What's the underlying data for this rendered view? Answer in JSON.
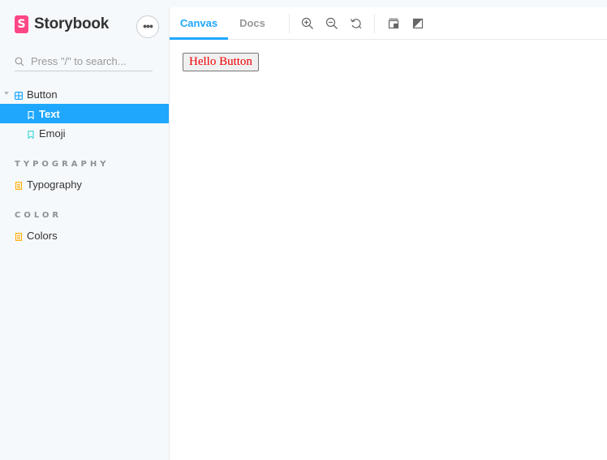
{
  "brand": {
    "logo_letter": "S",
    "name": "Storybook",
    "color": "#ff4785"
  },
  "sidebar": {
    "menu_label": "•••",
    "search_placeholder": "Press \"/\" to search...",
    "tree": {
      "component": "Button",
      "stories": [
        "Text",
        "Emoji"
      ],
      "selected_story": "Text"
    },
    "sections": [
      {
        "title": "TYPOGRAPHY",
        "item": "Typography"
      },
      {
        "title": "COLOR",
        "item": "Colors"
      }
    ]
  },
  "toolbar": {
    "tabs": [
      "Canvas",
      "Docs"
    ],
    "active_tab": "Canvas",
    "tools": [
      "zoom-in-icon",
      "zoom-out-icon",
      "reset-zoom-icon",
      "background-icon",
      "contrast-icon"
    ]
  },
  "canvas": {
    "button_label": "Hello Button"
  },
  "colors": {
    "accent": "#1ea7fd",
    "sidebar_bg": "#f6f9fc",
    "doc_icon": "#ffae00",
    "component_icon": "#1ea7fd",
    "story_icon": "#37d5d3",
    "button_text": "#ee0000"
  }
}
